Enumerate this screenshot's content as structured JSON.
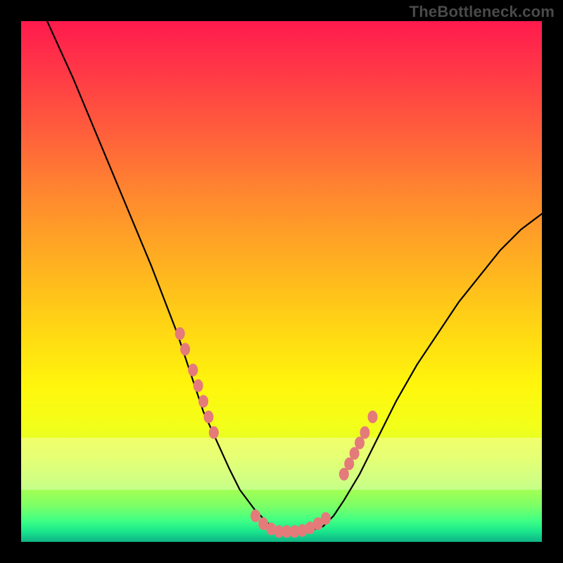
{
  "watermark": "TheBottleneck.com",
  "chart_data": {
    "type": "line",
    "title": "",
    "xlabel": "",
    "ylabel": "",
    "xlim": [
      0,
      100
    ],
    "ylim": [
      0,
      100
    ],
    "grid": false,
    "legend": false,
    "series": [
      {
        "name": "bottleneck-curve",
        "x": [
          0,
          5,
          10,
          15,
          20,
          25,
          30,
          33,
          35,
          40,
          42,
          45,
          48,
          50,
          52,
          55,
          58,
          60,
          62,
          65,
          68,
          72,
          76,
          80,
          84,
          88,
          92,
          96,
          100
        ],
        "y": [
          110,
          100,
          89,
          77,
          65,
          53,
          40,
          31,
          25,
          14,
          10,
          6,
          3,
          2,
          2,
          2,
          3,
          5,
          8,
          13,
          19,
          27,
          34,
          40,
          46,
          51,
          56,
          60,
          63
        ]
      }
    ],
    "markers": {
      "name": "marker-points",
      "color": "#e47a7a",
      "points": [
        {
          "x": 30.5,
          "y": 40
        },
        {
          "x": 31.5,
          "y": 37
        },
        {
          "x": 33.0,
          "y": 33
        },
        {
          "x": 34.0,
          "y": 30
        },
        {
          "x": 35.0,
          "y": 27
        },
        {
          "x": 36.0,
          "y": 24
        },
        {
          "x": 37.0,
          "y": 21
        },
        {
          "x": 45.0,
          "y": 5
        },
        {
          "x": 46.5,
          "y": 3.5
        },
        {
          "x": 48.0,
          "y": 2.5
        },
        {
          "x": 49.5,
          "y": 2
        },
        {
          "x": 51.0,
          "y": 2
        },
        {
          "x": 52.5,
          "y": 2
        },
        {
          "x": 54.0,
          "y": 2.2
        },
        {
          "x": 55.5,
          "y": 2.7
        },
        {
          "x": 57.0,
          "y": 3.5
        },
        {
          "x": 58.5,
          "y": 4.5
        },
        {
          "x": 62.0,
          "y": 13
        },
        {
          "x": 63.0,
          "y": 15
        },
        {
          "x": 64.0,
          "y": 17
        },
        {
          "x": 65.0,
          "y": 19
        },
        {
          "x": 66.0,
          "y": 21
        },
        {
          "x": 67.5,
          "y": 24
        }
      ]
    },
    "band": {
      "y_from": 10,
      "y_to": 20
    },
    "background_gradient": {
      "top": "#ff1a4d",
      "mid": "#ffd913",
      "bottom": "#0fb385"
    }
  }
}
